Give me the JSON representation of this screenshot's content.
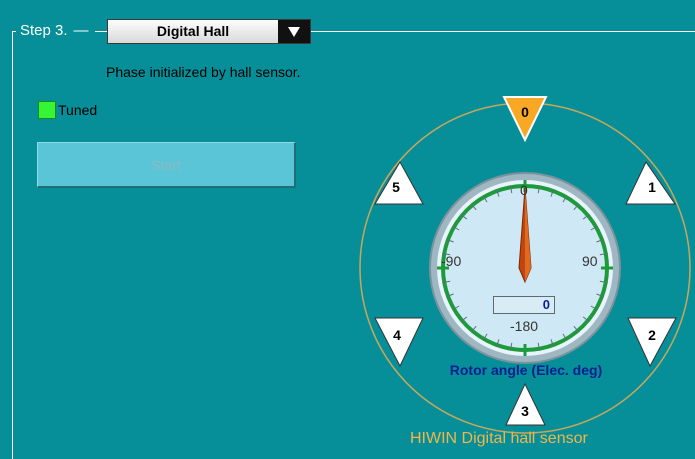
{
  "group": {
    "step_label": "Step 3.",
    "mode_select": {
      "value": "Digital Hall"
    },
    "description": "Phase initialized by hall sensor."
  },
  "status": {
    "tuned_label": "Tuned",
    "tuned_color": "#35f534"
  },
  "actions": {
    "start_label": "Start"
  },
  "gauge": {
    "sectors": [
      "0",
      "1",
      "2",
      "3",
      "4",
      "5"
    ],
    "active_sector": "0",
    "active_color": "#f8a825",
    "dial_labels": {
      "top": "0",
      "left": "-90",
      "right": "90",
      "bottom": "-180"
    },
    "angle_value": "0",
    "rotor_caption": "Rotor angle (Elec. deg)",
    "sensor_caption": "HIWIN Digital hall sensor"
  }
}
